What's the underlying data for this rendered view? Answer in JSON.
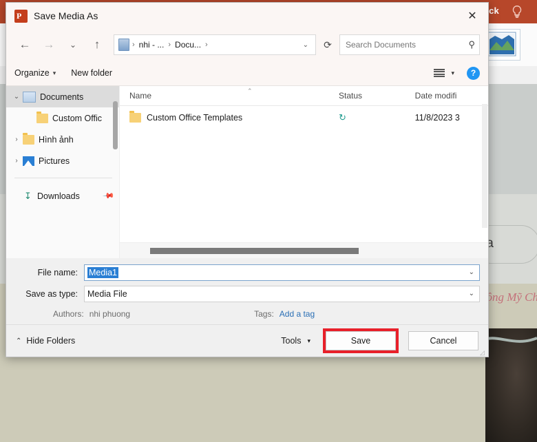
{
  "background_app": {
    "ribbon_tab": "yback",
    "bulb_icon": "lightbulb-icon",
    "picture_button_icon": "picture-icon",
    "slide_shape_text": "ta",
    "slide_red_text": "ông Mỹ Ch"
  },
  "dialog": {
    "title": "Save Media As",
    "app_icon": "powerpoint-icon",
    "app_icon_glyph": "P",
    "close_label": "✕",
    "nav": {
      "back": "←",
      "forward": "→",
      "recent": "⌄",
      "up": "↑",
      "refresh": "⟳",
      "breadcrumb_icon": "onedrive-folder-icon",
      "breadcrumb": [
        "nhi - ...",
        "Docu..."
      ],
      "breadcrumb_separator": "›",
      "breadcrumb_chevron": "⌄"
    },
    "search": {
      "placeholder": "Search Documents",
      "value": "",
      "icon": "search-icon"
    },
    "toolbar": {
      "organize": "Organize",
      "organize_caret": "▾",
      "new_folder": "New folder",
      "view_icon": "view-layout-icon",
      "view_caret": "▾",
      "help": "?"
    },
    "sidebar": {
      "items": [
        {
          "label": "Documents",
          "icon": "documents-icon",
          "chevron": "⌄",
          "selected": true,
          "indent": 0
        },
        {
          "label": "Custom Offic",
          "icon": "folder-icon",
          "chevron": "",
          "selected": false,
          "indent": 1
        },
        {
          "label": "Hình ảnh",
          "icon": "folder-icon",
          "chevron": "›",
          "selected": false,
          "indent": 0
        },
        {
          "label": "Pictures",
          "icon": "pictures-icon",
          "chevron": "›",
          "selected": false,
          "indent": 0
        }
      ],
      "downloads": {
        "label": "Downloads",
        "icon": "download-icon",
        "pin": "pin-icon"
      }
    },
    "file_list": {
      "columns": [
        "Name",
        "Status",
        "Date modifi"
      ],
      "sort_caret": "⌃",
      "rows": [
        {
          "name": "Custom Office Templates",
          "icon": "folder-icon",
          "status_icon": "sync-icon",
          "date": "11/8/2023 3"
        }
      ]
    },
    "form": {
      "file_name_label": "File name:",
      "file_name_value": "Media1",
      "save_as_type_label": "Save as type:",
      "save_as_type_value": "Media File",
      "dropdown_caret": "⌄",
      "authors_label": "Authors:",
      "authors_value": "nhi phuong",
      "tags_label": "Tags:",
      "tags_value": "Add a tag"
    },
    "footer": {
      "hide_folders": "Hide Folders",
      "hide_folders_chevron": "⌃",
      "tools": "Tools",
      "tools_caret": "▾",
      "save": "Save",
      "cancel": "Cancel",
      "save_highlight_color": "#e8202a"
    }
  }
}
